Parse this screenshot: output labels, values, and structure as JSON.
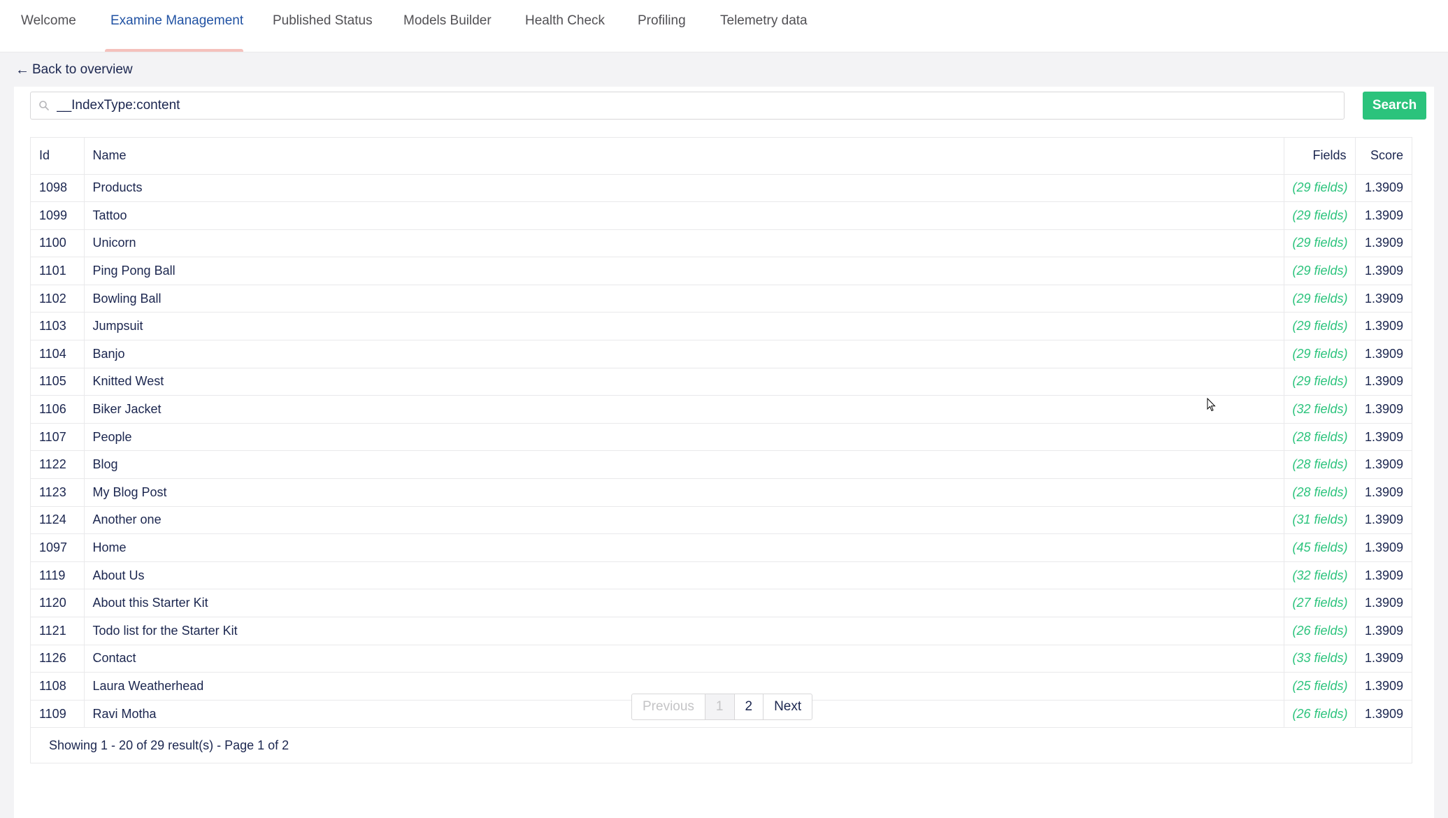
{
  "tabs": [
    {
      "label": "Welcome"
    },
    {
      "label": "Examine Management"
    },
    {
      "label": "Published Status"
    },
    {
      "label": "Models Builder"
    },
    {
      "label": "Health Check"
    },
    {
      "label": "Profiling"
    },
    {
      "label": "Telemetry data"
    }
  ],
  "active_tab": "Examine Management",
  "back_link": {
    "arrow": "←",
    "label": "Back to overview"
  },
  "search": {
    "value": "__IndexType:content",
    "button": "Search",
    "icon": "search-icon"
  },
  "table": {
    "headers": {
      "id": "Id",
      "name": "Name",
      "fields": "Fields",
      "score": "Score"
    },
    "rows": [
      {
        "id": "1098",
        "name": "Products",
        "fields": "(29 fields)",
        "score": "1.3909"
      },
      {
        "id": "1099",
        "name": "Tattoo",
        "fields": "(29 fields)",
        "score": "1.3909"
      },
      {
        "id": "1100",
        "name": "Unicorn",
        "fields": "(29 fields)",
        "score": "1.3909"
      },
      {
        "id": "1101",
        "name": "Ping Pong Ball",
        "fields": "(29 fields)",
        "score": "1.3909"
      },
      {
        "id": "1102",
        "name": "Bowling Ball",
        "fields": "(29 fields)",
        "score": "1.3909"
      },
      {
        "id": "1103",
        "name": "Jumpsuit",
        "fields": "(29 fields)",
        "score": "1.3909"
      },
      {
        "id": "1104",
        "name": "Banjo",
        "fields": "(29 fields)",
        "score": "1.3909"
      },
      {
        "id": "1105",
        "name": "Knitted West",
        "fields": "(29 fields)",
        "score": "1.3909"
      },
      {
        "id": "1106",
        "name": "Biker Jacket",
        "fields": "(32 fields)",
        "score": "1.3909"
      },
      {
        "id": "1107",
        "name": "People",
        "fields": "(28 fields)",
        "score": "1.3909"
      },
      {
        "id": "1122",
        "name": "Blog",
        "fields": "(28 fields)",
        "score": "1.3909"
      },
      {
        "id": "1123",
        "name": "My Blog Post",
        "fields": "(28 fields)",
        "score": "1.3909"
      },
      {
        "id": "1124",
        "name": "Another one",
        "fields": "(31 fields)",
        "score": "1.3909"
      },
      {
        "id": "1097",
        "name": "Home",
        "fields": "(45 fields)",
        "score": "1.3909"
      },
      {
        "id": "1119",
        "name": "About Us",
        "fields": "(32 fields)",
        "score": "1.3909"
      },
      {
        "id": "1120",
        "name": "About this Starter Kit",
        "fields": "(27 fields)",
        "score": "1.3909"
      },
      {
        "id": "1121",
        "name": "Todo list for the Starter Kit",
        "fields": "(26 fields)",
        "score": "1.3909"
      },
      {
        "id": "1126",
        "name": "Contact",
        "fields": "(33 fields)",
        "score": "1.3909"
      },
      {
        "id": "1108",
        "name": "Laura Weatherhead",
        "fields": "(25 fields)",
        "score": "1.3909"
      },
      {
        "id": "1109",
        "name": "Ravi Motha",
        "fields": "(26 fields)",
        "score": "1.3909"
      }
    ],
    "summary": "Showing 1 - 20 of 29 result(s) - Page 1 of 2"
  },
  "pager": {
    "previous": "Previous",
    "pages": [
      "1",
      "2"
    ],
    "current": "1",
    "next": "Next"
  },
  "colors": {
    "accent": "#2bc37c",
    "active_tab": "#2152a3",
    "tab_underline": "#f5c1bc",
    "text": "#1b264f"
  }
}
